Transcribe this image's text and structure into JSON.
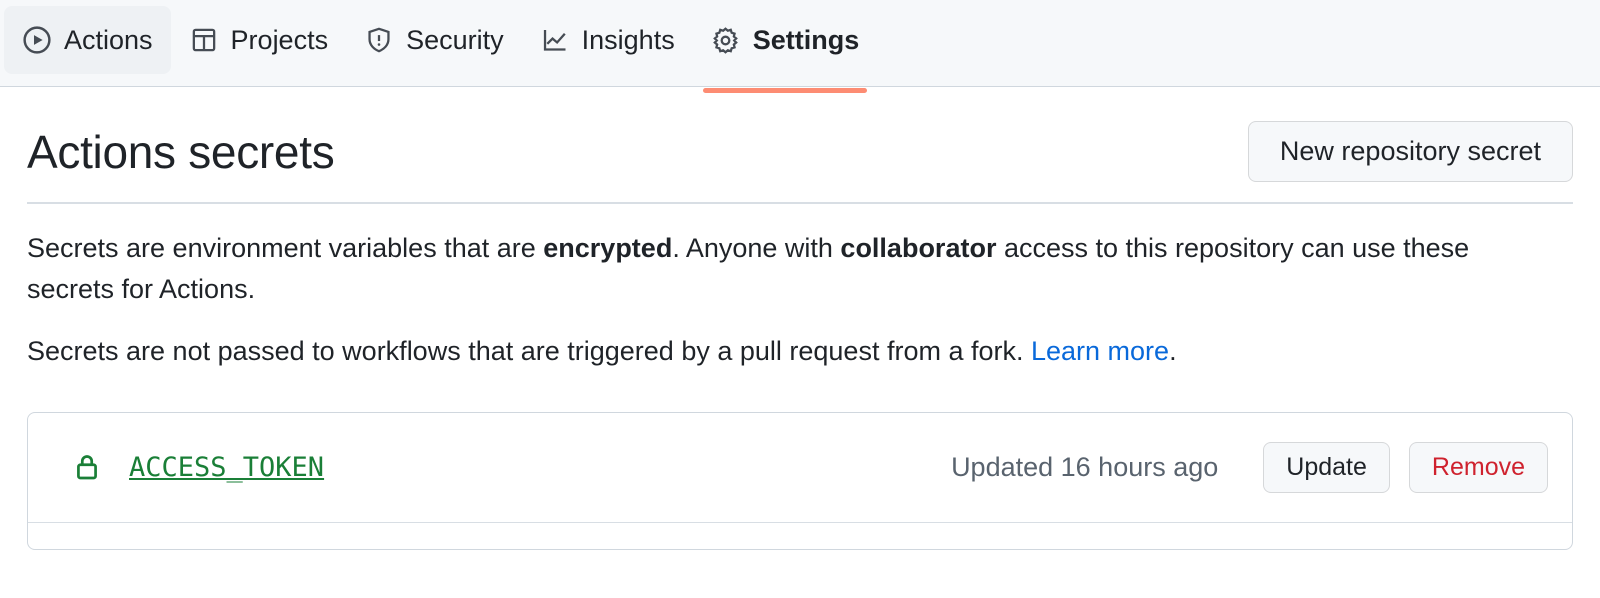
{
  "tabs": [
    {
      "label": "Actions",
      "icon": "play-circle-icon",
      "state": "hovered"
    },
    {
      "label": "Projects",
      "icon": "table-icon",
      "state": "default"
    },
    {
      "label": "Security",
      "icon": "shield-alert-icon",
      "state": "default"
    },
    {
      "label": "Insights",
      "icon": "graph-icon",
      "state": "default"
    },
    {
      "label": "Settings",
      "icon": "gear-icon",
      "state": "selected"
    }
  ],
  "header": {
    "title": "Actions secrets",
    "new_secret_label": "New repository secret"
  },
  "description": {
    "line1_part1": "Secrets are environment variables that are ",
    "line1_bold1": "encrypted",
    "line1_part2": ". Anyone with ",
    "line1_bold2": "collaborator",
    "line1_part3": " access to this repository can use these secrets for Actions.",
    "line2_part1": "Secrets are not passed to workflows that are triggered by a pull request from a fork. ",
    "line2_link": "Learn more",
    "line2_part2": "."
  },
  "secrets": [
    {
      "name": "ACCESS_TOKEN",
      "icon": "lock-icon",
      "updated": "Updated 16 hours ago",
      "update_label": "Update",
      "remove_label": "Remove"
    }
  ],
  "colors": {
    "accent_underline": "#fd8c73",
    "link": "#0969da",
    "secret_green": "#1a7f37",
    "danger_red": "#cf222e",
    "muted_text": "#59636e",
    "tabbar_bg": "#f6f8fa",
    "border": "#d0d7de"
  }
}
